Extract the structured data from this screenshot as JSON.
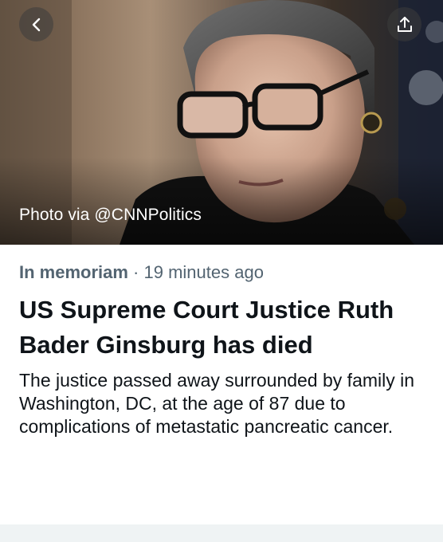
{
  "hero": {
    "photo_credit": "Photo via @CNNPolitics",
    "back_icon": "chevron-left-icon",
    "share_icon": "share-icon"
  },
  "article": {
    "category": "In memoriam",
    "separator": " · ",
    "time_ago": "19 minutes ago",
    "headline": "US Supreme Court Justice Ruth Bader Ginsburg has died",
    "summary": "The justice passed away surrounded by family in Washington, DC, at the age of 87 due to complications of metastatic pancreatic cancer."
  },
  "colors": {
    "text_primary": "#0f1419",
    "text_secondary": "#536471",
    "footer": "#eff3f4"
  }
}
